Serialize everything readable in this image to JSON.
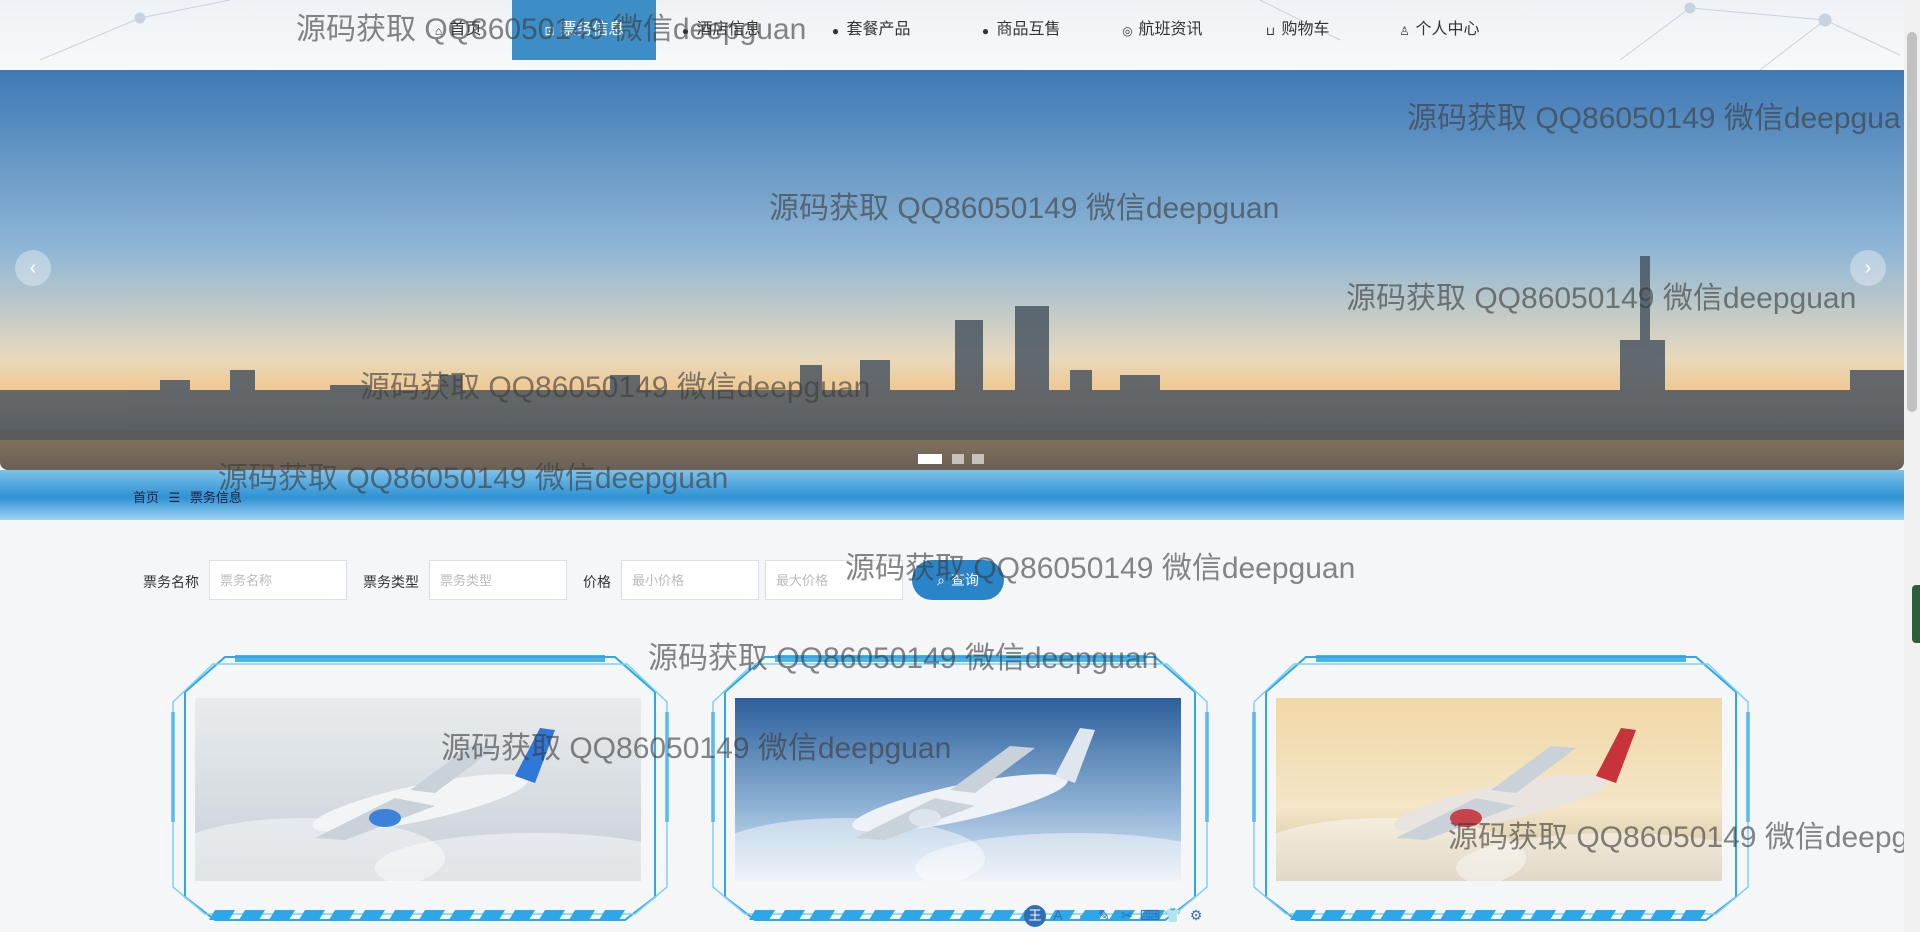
{
  "nav": {
    "items": [
      {
        "label": "首页",
        "icon": "home-icon",
        "active": false
      },
      {
        "label": "票务信息",
        "icon": "ticket-icon",
        "active": true
      },
      {
        "label": "酒店信息",
        "icon": "info-circle-icon",
        "active": false
      },
      {
        "label": "套餐产品",
        "icon": "question-circle-icon",
        "active": false
      },
      {
        "label": "商品互售",
        "icon": "info-circle-icon",
        "active": false
      },
      {
        "label": "航班资讯",
        "icon": "target-icon",
        "active": false
      },
      {
        "label": "购物车",
        "icon": "cart-icon",
        "active": false
      },
      {
        "label": "个人中心",
        "icon": "user-icon",
        "active": false
      }
    ]
  },
  "banner": {
    "prev": "‹",
    "next": "›",
    "slide_count": 3,
    "current_slide": 1
  },
  "breadcrumb": {
    "home": "首页",
    "separator": "☰",
    "current": "票务信息"
  },
  "search": {
    "name_label": "票务名称",
    "name_placeholder": "票务名称",
    "type_label": "票务类型",
    "type_placeholder": "票务类型",
    "price_label": "价格",
    "min_placeholder": "最小价格",
    "max_placeholder": "最大价格",
    "button": "查询"
  },
  "cards": [
    {
      "image": "airplane-clouds-photo"
    },
    {
      "image": "airplane-blue-sky-photo"
    },
    {
      "image": "airplane-sunset-photo"
    }
  ],
  "watermark": "源码获取 QQ86050149 微信deepguan",
  "watermark_edge": "源码获取 QQ86050149 微信deepgua",
  "watermark_edge2": "源码获取 QQ86050149 微信deepg",
  "ime_toolbar": {
    "logo": "王",
    "buttons": [
      "A",
      "·",
      "✎",
      "✂",
      "⌨",
      "👕",
      "⚙"
    ]
  }
}
